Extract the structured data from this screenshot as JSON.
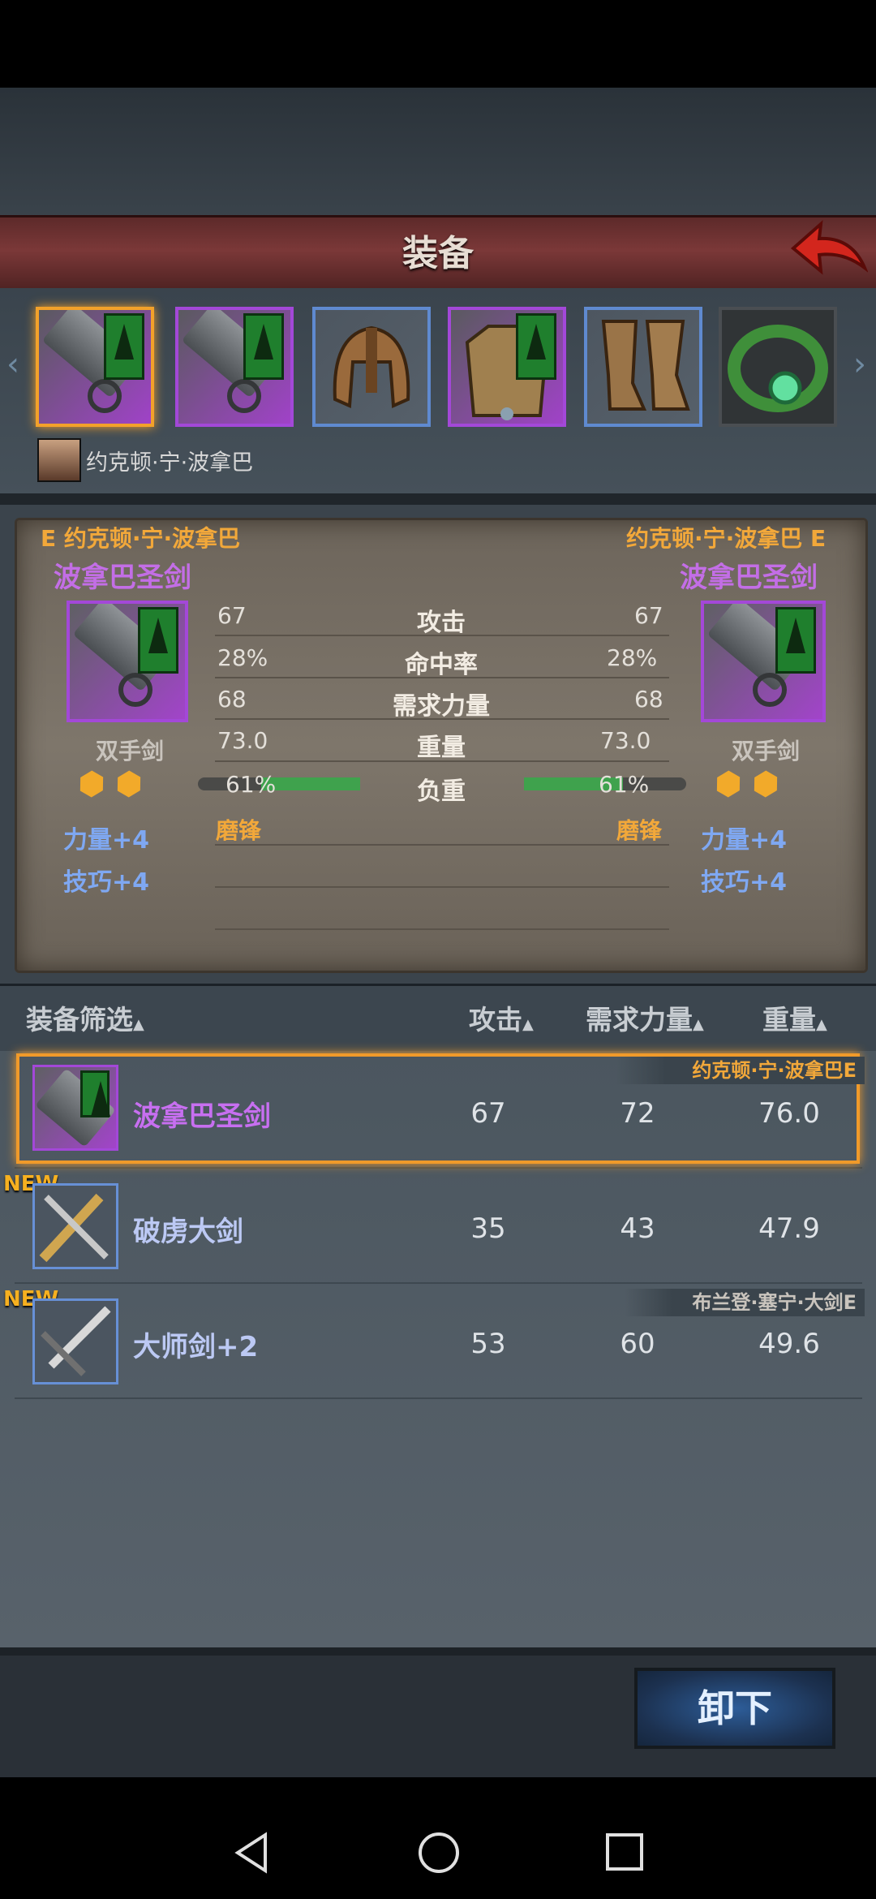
{
  "title": "装备",
  "character": {
    "name": "约克顿·宁·波拿巴"
  },
  "slots": [
    {
      "icon": "greatsword-icon"
    },
    {
      "icon": "greatsword-icon"
    },
    {
      "icon": "helmet-icon"
    },
    {
      "icon": "armor-icon"
    },
    {
      "icon": "boots-icon"
    },
    {
      "icon": "ring-icon"
    }
  ],
  "compare": {
    "left": {
      "owner": "E 约克顿·宁·波拿巴",
      "weapon": "波拿巴圣剑",
      "type": "双手剑",
      "stats": [
        "67",
        "28%",
        "68",
        "73.0"
      ],
      "load": "61%",
      "load_value": 0.61,
      "skill": "磨锋",
      "bonuses": [
        "力量+4",
        "技巧+4"
      ]
    },
    "right": {
      "owner": "约克顿·宁·波拿巴 E",
      "weapon": "波拿巴圣剑",
      "type": "双手剑",
      "stats": [
        "67",
        "28%",
        "68",
        "73.0"
      ],
      "load": "61%",
      "load_value": 0.61,
      "skill": "磨锋",
      "bonuses": [
        "力量+4",
        "技巧+4"
      ]
    },
    "labels": [
      "攻击",
      "命中率",
      "需求力量",
      "重量",
      "负重"
    ]
  },
  "list": {
    "headers": {
      "filter": "装备筛选",
      "attack": "攻击",
      "str_req": "需求力量",
      "weight": "重量"
    },
    "items": [
      {
        "name": "波拿巴圣剑",
        "attack": "67",
        "str_req": "72",
        "weight": "76.0",
        "owner": "约克顿·宁·波拿巴E",
        "new": ""
      },
      {
        "name": "破虏大剑",
        "attack": "35",
        "str_req": "43",
        "weight": "47.9",
        "owner": "",
        "new": "NEW"
      },
      {
        "name": "大师剑+2",
        "attack": "53",
        "str_req": "60",
        "weight": "49.6",
        "owner": "布兰登·塞宁·大剑E",
        "new": "NEW"
      }
    ]
  },
  "actions": {
    "unequip": "卸下"
  },
  "colors": {
    "accent": "#f3a12a",
    "rarity_purple": "#a348d8",
    "rarity_blue": "#5f8ad0",
    "title_bar": "#7b3838"
  }
}
